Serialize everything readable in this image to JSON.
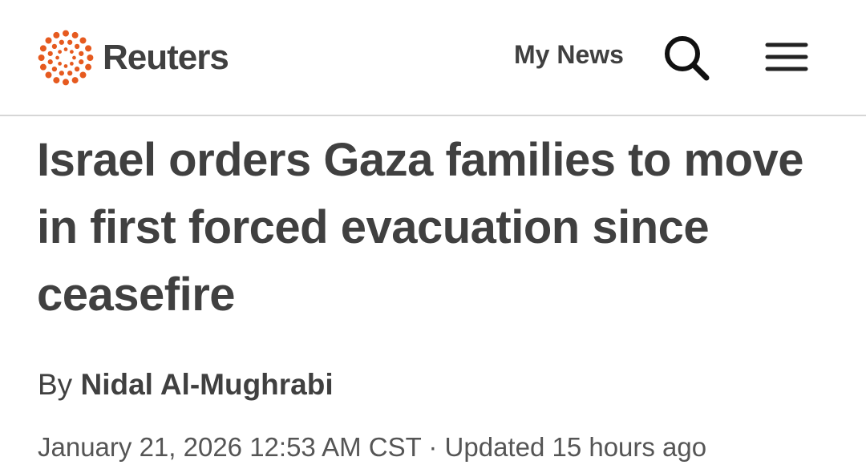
{
  "header": {
    "logo_text": "Reuters",
    "my_news_label": "My News",
    "brand_color": "#e65a1f",
    "search_icon": "search-icon",
    "menu_icon": "hamburger-menu-icon"
  },
  "article": {
    "headline": "Israel orders Gaza families to move in first forced evacuation since ceasefire",
    "byline_prefix": "By",
    "author": "Nidal Al-Mughrabi",
    "date": "January 21, 2026 12:53 AM CST",
    "separator": " · ",
    "updated": "Updated 15 hours ago"
  }
}
